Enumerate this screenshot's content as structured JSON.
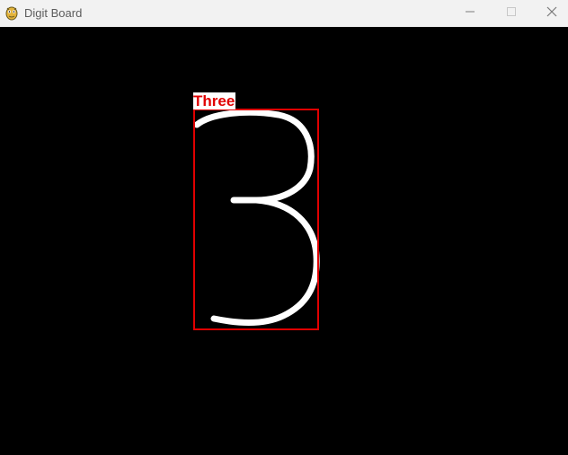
{
  "window": {
    "title": "Digit Board",
    "app_icon": "pygame-snake-icon",
    "controls": [
      "minimize-icon",
      "maximize-icon",
      "close-icon"
    ]
  },
  "board": {
    "background_color": "#000000",
    "stroke_color": "#ffffff",
    "drawn_digit": "3"
  },
  "prediction": {
    "label": "Three",
    "box_color": "#e00000",
    "label_background": "#ffffff"
  }
}
